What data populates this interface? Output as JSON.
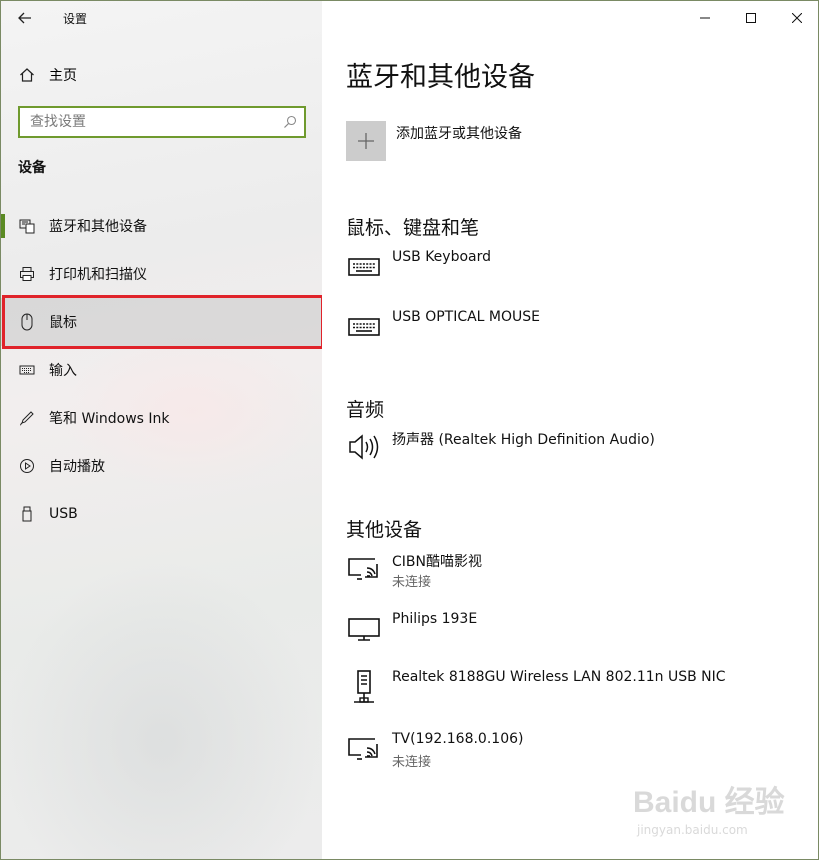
{
  "window": {
    "title": "设置"
  },
  "sidebar": {
    "home_label": "主页",
    "search_placeholder": "查找设置",
    "section_title": "设备",
    "items": [
      {
        "label": "蓝牙和其他设备",
        "icon": "bluetooth-devices-icon",
        "active": true
      },
      {
        "label": "打印机和扫描仪",
        "icon": "printer-icon"
      },
      {
        "label": "鼠标",
        "icon": "mouse-icon",
        "highlighted": true
      },
      {
        "label": "输入",
        "icon": "keyboard-icon"
      },
      {
        "label": "笔和 Windows Ink",
        "icon": "pen-icon"
      },
      {
        "label": "自动播放",
        "icon": "autoplay-icon"
      },
      {
        "label": "USB",
        "icon": "usb-icon"
      }
    ]
  },
  "main": {
    "title": "蓝牙和其他设备",
    "add_label": "添加蓝牙或其他设备",
    "groups": [
      {
        "title": "鼠标、键盘和笔",
        "devices": [
          {
            "name": "USB Keyboard",
            "icon": "keyboard-icon"
          },
          {
            "name": "USB OPTICAL MOUSE",
            "icon": "keyboard-icon"
          }
        ]
      },
      {
        "title": "音频",
        "devices": [
          {
            "name": "扬声器 (Realtek High Definition Audio)",
            "icon": "speaker-icon"
          }
        ]
      },
      {
        "title": "其他设备",
        "devices": [
          {
            "name": "CIBN酷喵影视",
            "status": "未连接",
            "icon": "cast-display-icon"
          },
          {
            "name": "Philips 193E",
            "icon": "monitor-icon"
          },
          {
            "name": "Realtek 8188GU Wireless LAN 802.11n USB NIC",
            "icon": "network-adapter-icon"
          },
          {
            "name": "TV(192.168.0.106)",
            "status": "未连接",
            "icon": "cast-display-icon"
          }
        ]
      }
    ]
  },
  "watermark": {
    "brand": "Baidu 经验",
    "url": "jingyan.baidu.com"
  },
  "colors": {
    "accent": "#5a8a23",
    "search_border": "#6f9a2e",
    "highlight_box": "#e0232a"
  }
}
